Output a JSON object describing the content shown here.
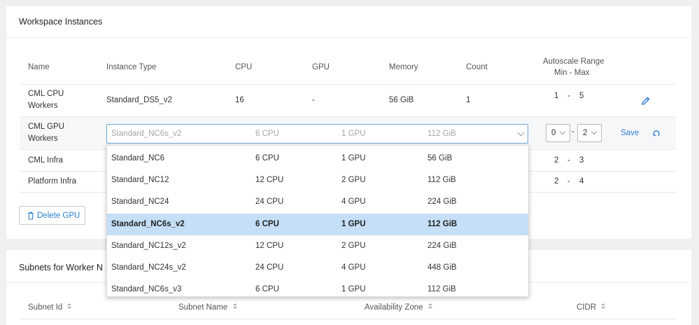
{
  "workspace": {
    "title": "Workspace Instances",
    "headers": {
      "name": "Name",
      "instance_type": "Instance Type",
      "cpu": "CPU",
      "gpu": "GPU",
      "memory": "Memory",
      "count": "Count",
      "autoscale_line1": "Autoscale Range",
      "autoscale_line2": "Min - Max"
    },
    "rows": [
      {
        "name_l1": "CML CPU",
        "name_l2": "Workers",
        "instance_type": "Standard_DS5_v2",
        "cpu": "16",
        "gpu": "-",
        "memory": "56 GiB",
        "count": "1",
        "min": "1",
        "sep": "-",
        "max": "5"
      },
      {
        "name_l1": "CML GPU",
        "name_l2": "Workers"
      },
      {
        "name": "CML Infra",
        "min": "2",
        "sep": "-",
        "max": "3"
      },
      {
        "name": "Platform Infra",
        "min": "2",
        "sep": "-",
        "max": "4"
      }
    ],
    "edit_row": {
      "selected": {
        "type": "Standard_NC6s_v2",
        "cpu": "6 CPU",
        "gpu": "1 GPU",
        "memory": "112 GiB"
      },
      "min_value": "0",
      "sep": "-",
      "max_value": "2",
      "save_label": "Save"
    },
    "options": [
      {
        "type": "Standard_NC6",
        "cpu": "6 CPU",
        "gpu": "1 GPU",
        "memory": "56 GiB"
      },
      {
        "type": "Standard_NC12",
        "cpu": "12 CPU",
        "gpu": "2 GPU",
        "memory": "112 GiB"
      },
      {
        "type": "Standard_NC24",
        "cpu": "24 CPU",
        "gpu": "4 GPU",
        "memory": "224 GiB"
      },
      {
        "type": "Standard_NC6s_v2",
        "cpu": "6 CPU",
        "gpu": "1 GPU",
        "memory": "112 GiB"
      },
      {
        "type": "Standard_NC12s_v2",
        "cpu": "12 CPU",
        "gpu": "2 GPU",
        "memory": "224 GiB"
      },
      {
        "type": "Standard_NC24s_v2",
        "cpu": "24 CPU",
        "gpu": "4 GPU",
        "memory": "448 GiB"
      },
      {
        "type": "Standard_NC6s_v3",
        "cpu": "6 CPU",
        "gpu": "1 GPU",
        "memory": "112 GiB"
      }
    ],
    "selected_option_index": 3,
    "delete_gpu_label": "Delete GPU"
  },
  "subnets": {
    "title": "Subnets for Worker N",
    "headers": {
      "subnet_id": "Subnet Id",
      "subnet_name": "Subnet Name",
      "availability_zone": "Availability Zone",
      "cidr": "CIDR"
    }
  },
  "colors": {
    "accent": "#2f7fd1",
    "selected_row": "#c4dff6",
    "focus_border": "#6ea5d9"
  }
}
